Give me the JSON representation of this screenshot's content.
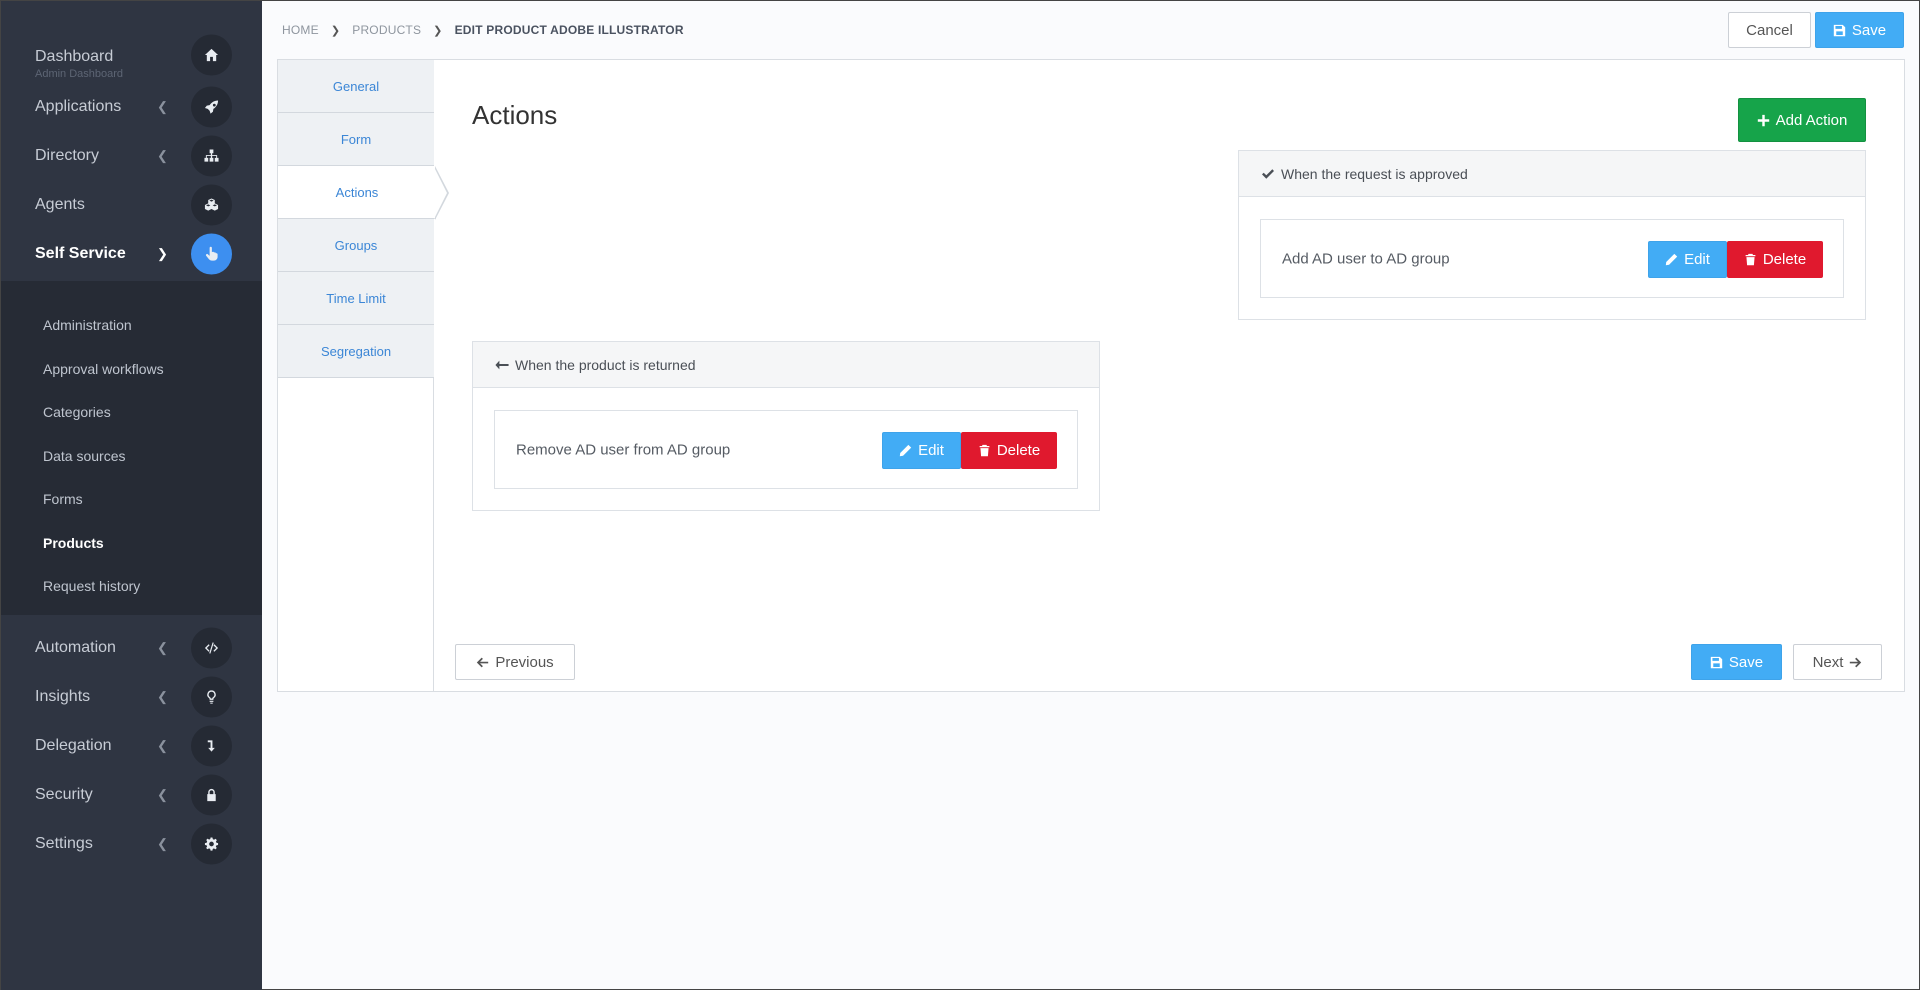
{
  "sidebar": {
    "items": [
      {
        "label": "Dashboard",
        "sublabel": "Admin Dashboard",
        "icon": "home-icon"
      },
      {
        "label": "Applications",
        "icon": "rocket-icon"
      },
      {
        "label": "Directory",
        "icon": "sitemap-icon"
      },
      {
        "label": "Agents",
        "icon": "cubes-icon"
      },
      {
        "label": "Self Service",
        "icon": "hand-pointer-icon"
      },
      {
        "label": "Automation",
        "icon": "code-icon"
      },
      {
        "label": "Insights",
        "icon": "lightbulb-icon"
      },
      {
        "label": "Delegation",
        "icon": "level-down-icon"
      },
      {
        "label": "Security",
        "icon": "lock-icon"
      },
      {
        "label": "Settings",
        "icon": "gear-icon"
      }
    ],
    "self_service_items": [
      "Administration",
      "Approval workflows",
      "Categories",
      "Data sources",
      "Forms",
      "Products",
      "Request history"
    ],
    "active_item": "Self Service",
    "active_sub_item": "Products",
    "active_color": "#3d8ff0"
  },
  "breadcrumb": {
    "home": "HOME",
    "products": "PRODUCTS",
    "current": "EDIT PRODUCT ADOBE ILLUSTRATOR"
  },
  "header": {
    "cancel_label": "Cancel",
    "save_label": "Save"
  },
  "tabs": [
    "General",
    "Form",
    "Actions",
    "Groups",
    "Time Limit",
    "Segregation"
  ],
  "active_tab": "Actions",
  "main": {
    "heading": "Actions",
    "add_action_label": "Add Action",
    "approved_group": {
      "title": "When the request is approved",
      "action": "Add AD user to AD group",
      "edit_label": "Edit",
      "delete_label": "Delete"
    },
    "returned_group": {
      "title": "When the product is returned",
      "action": "Remove AD user from AD group",
      "edit_label": "Edit",
      "delete_label": "Delete"
    }
  },
  "footer": {
    "previous_label": "Previous",
    "save_label": "Save",
    "next_label": "Next"
  },
  "colors": {
    "sidebar_bg": "#2f3542",
    "primary_blue": "#42acf5",
    "success_green": "#16a44a",
    "danger_red": "#e0192e",
    "link_blue": "#3b86d6"
  }
}
